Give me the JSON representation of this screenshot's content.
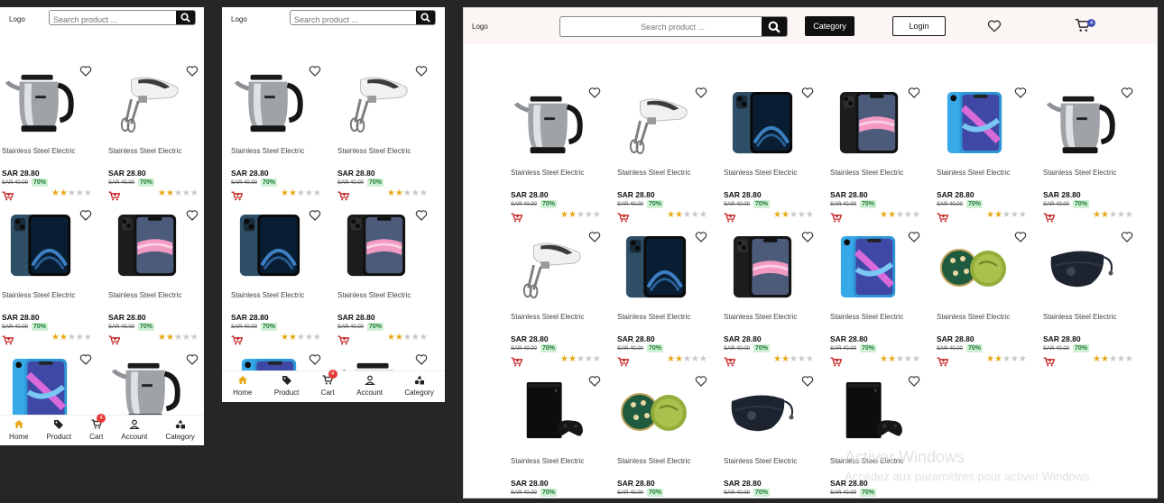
{
  "header": {
    "logo": "Logo",
    "search_placeholder": "Search product ...",
    "category_label": "Category",
    "login_label": "Login",
    "cart_count": "4"
  },
  "bottom_nav": [
    {
      "label": "Home",
      "icon": "home-icon",
      "active": true
    },
    {
      "label": "Product",
      "icon": "tag-icon"
    },
    {
      "label": "Cart",
      "icon": "cart-icon",
      "badge": "4"
    },
    {
      "label": "Account",
      "icon": "account-icon"
    },
    {
      "label": "Category",
      "icon": "category-icon"
    }
  ],
  "product_template": {
    "name": "Stainless Steel Electric",
    "price": "SAR 28.80",
    "old_price": "SAR 40.00",
    "discount": "70%",
    "rating": 2,
    "rating_max": 5
  },
  "products": [
    {
      "image": "kettle"
    },
    {
      "image": "mixer"
    },
    {
      "image": "iphone-blue"
    },
    {
      "image": "iphone-black"
    },
    {
      "image": "iphone-xr-blue"
    },
    {
      "image": "kettle"
    },
    {
      "image": "mixer"
    },
    {
      "image": "iphone-blue"
    },
    {
      "image": "iphone-black"
    },
    {
      "image": "iphone-xr-blue"
    },
    {
      "image": "eye-patches"
    },
    {
      "image": "face-mask"
    },
    {
      "image": "console"
    },
    {
      "image": "eye-patches"
    },
    {
      "image": "face-mask"
    },
    {
      "image": "console"
    }
  ],
  "mobile_products_small": [
    "kettle",
    "mixer",
    "iphone-blue",
    "iphone-black",
    "iphone-xr-blue",
    "kettle"
  ],
  "mobile_products_mid": [
    "kettle",
    "mixer",
    "iphone-blue",
    "iphone-black",
    "iphone-xr-blue",
    "kettle"
  ],
  "watermark": {
    "line1": "Activer Windows",
    "line2": "Accédez aux paramètres pour activer Windows."
  },
  "colors": {
    "dark": "#111111",
    "header_bg": "#fbf6f4",
    "discount_bg": "#cff0d4",
    "discount_text": "#1d7a33",
    "star_on": "#e6a817",
    "cart_icon": "#c62828",
    "badge_red": "#e53935",
    "badge_blue": "#3f51b5",
    "nav_active": "#e6a817"
  }
}
